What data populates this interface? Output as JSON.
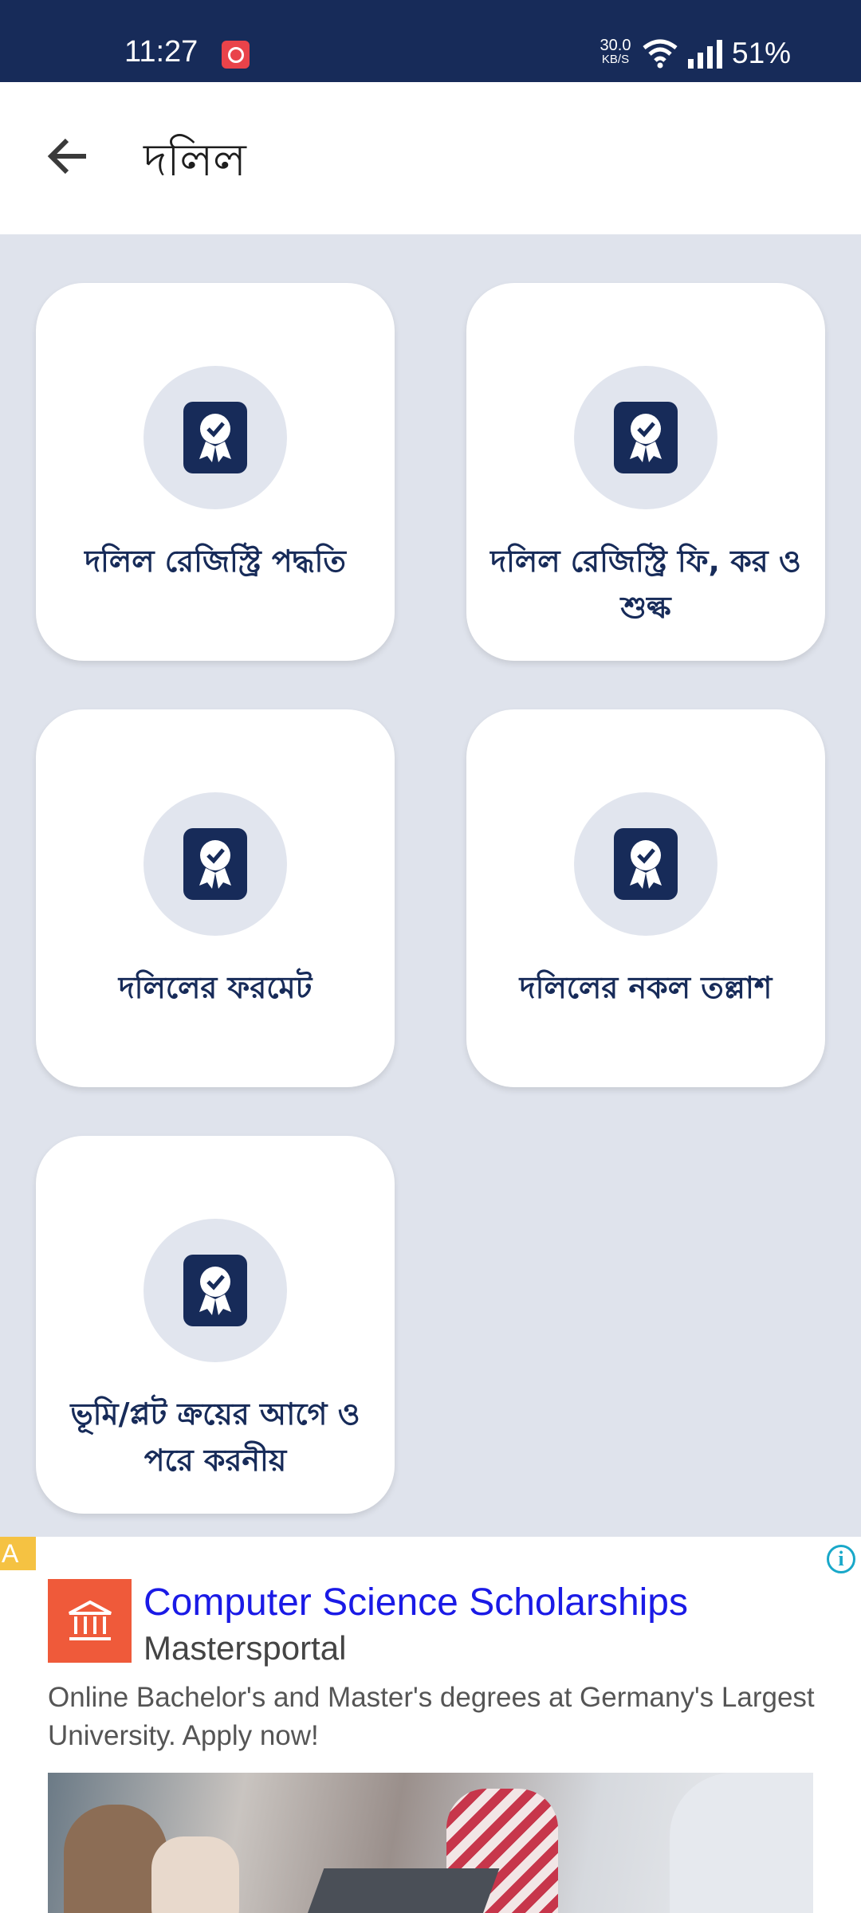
{
  "status_bar": {
    "time": "11:27",
    "speed_value": "30.0",
    "speed_unit": "KB/S",
    "battery": "51%",
    "icons": [
      "notification-app-icon",
      "wifi-icon",
      "signal-icon"
    ]
  },
  "app_bar": {
    "title": "দলিল",
    "back_icon": "arrow-left-icon"
  },
  "cards": [
    {
      "label": "দলিল রেজিস্ট্রি পদ্ধতি",
      "icon": "certificate-icon"
    },
    {
      "label": "দলিল রেজিস্ট্রি ফি, কর ও শুল্ক",
      "icon": "certificate-icon"
    },
    {
      "label": "দলিলের ফরমেট",
      "icon": "certificate-icon"
    },
    {
      "label": "দলিলের নকল তল্লাশ",
      "icon": "certificate-icon"
    },
    {
      "label": "ভূমি/প্লট ক্রয়ের আগে ও পরে করনীয়",
      "icon": "certificate-icon"
    }
  ],
  "ad": {
    "badge": "A",
    "info": "i",
    "title": "Computer Science Scholarships",
    "advertiser": "Mastersportal",
    "description": "Online Bachelor's and Master's degrees at Germany's Largest University. Apply now!"
  },
  "colors": {
    "status_bar": "#172b59",
    "background": "#dfe3ec",
    "card_text": "#172b59",
    "icon_circle": "#e1e5ee",
    "ad_title": "#1a1ae6",
    "ad_logo": "#ef5a3a"
  }
}
